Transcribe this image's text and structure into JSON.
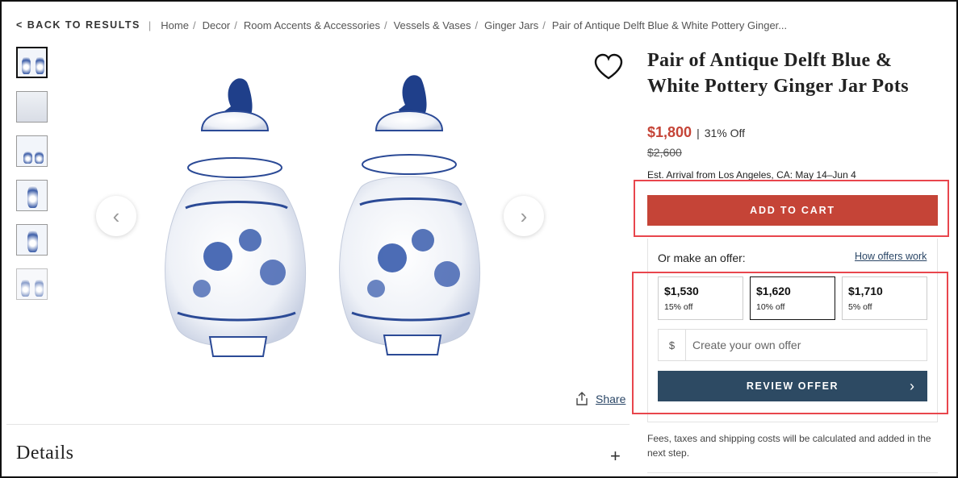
{
  "breadcrumb": {
    "back_label": "< BACK TO RESULTS",
    "separator": "|",
    "items": [
      "Home",
      "Decor",
      "Room Accents & Accessories",
      "Vessels & Vases",
      "Ginger Jars",
      "Pair of Antique Delft Blue & White Pottery Ginger..."
    ],
    "slash": "/"
  },
  "gallery": {
    "thumbnail_count": 6,
    "active_thumbnail": 0,
    "prev_icon": "chevron-left-icon",
    "next_icon": "chevron-right-icon",
    "prev_glyph": "‹",
    "next_glyph": "›",
    "image_description_icon": "ginger-jar-pair-image"
  },
  "favorite_icon": "heart-icon",
  "share_label": "Share",
  "details_label": "Details",
  "details_toggle": "+",
  "product": {
    "title": "Pair of Antique Delft Blue & White Pottery Ginger Jar Pots",
    "price": "$1,800",
    "price_sep": "|",
    "discount": "31% Off",
    "original_price": "$2,600",
    "eta": "Est. Arrival from Los Angeles, CA: May 14–Jun 4"
  },
  "cart": {
    "label": "ADD TO CART",
    "color": "#c54437"
  },
  "offer": {
    "label": "Or make an offer:",
    "how_link": "How offers work",
    "options": [
      {
        "amount": "$1,530",
        "off": "15% off",
        "selected": false
      },
      {
        "amount": "$1,620",
        "off": "10% off",
        "selected": true
      },
      {
        "amount": "$1,710",
        "off": "5% off",
        "selected": false
      }
    ],
    "currency": "$",
    "own_placeholder": "Create your own offer",
    "review_label": "REVIEW OFFER",
    "review_glyph": "›",
    "review_color": "#2d4a63"
  },
  "fees_note": "Fees, taxes and shipping costs will be calculated and added in the next step.",
  "highlight_color": "#e8464d"
}
